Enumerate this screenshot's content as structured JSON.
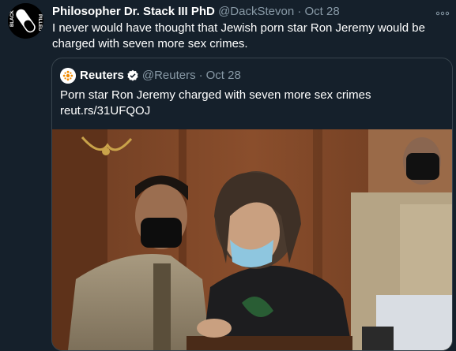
{
  "tweet": {
    "author_name": "Philosopher Dr. Stack III PhD",
    "handle": "@DackStevon",
    "separator": "·",
    "date": "Oct 28",
    "text": "I never would have thought that Jewish porn star Ron Jeremy would be charged with seven more sex crimes.",
    "avatar_text_left": "BLACK",
    "avatar_text_right": "PILLED",
    "more_icon": "ellipsis-icon"
  },
  "quoted_tweet": {
    "author_name": "Reuters",
    "handle": "@Reuters",
    "separator": "·",
    "date": "Oct 28",
    "text": "Porn star Ron Jeremy charged with seven more sex crimes",
    "link": "reut.rs/31UFQOJ",
    "verified_icon": "verified-badge-icon"
  },
  "colors": {
    "background": "#15202b",
    "muted_text": "#8899a6",
    "border": "#38444d",
    "verified": "#1da1f2",
    "reuters_orange": "#f08a00"
  }
}
